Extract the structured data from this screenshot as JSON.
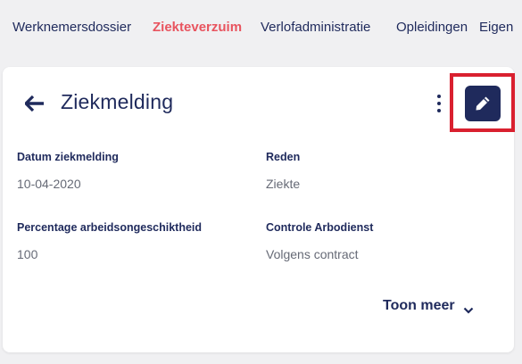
{
  "nav": {
    "tabs": [
      {
        "label": "Werknemersdossier"
      },
      {
        "label": "Ziekteverzuim"
      },
      {
        "label": "Verlofadministratie"
      },
      {
        "label": "Opleidingen"
      },
      {
        "label": "Eigen"
      }
    ],
    "active_tab": "Ziekteverzuim"
  },
  "card": {
    "title": "Ziekmelding",
    "fields": [
      {
        "label": "Datum ziekmelding",
        "value": "10-04-2020"
      },
      {
        "label": "Reden",
        "value": "Ziekte"
      },
      {
        "label": "Percentage arbeidsongeschiktheid",
        "value": "100"
      },
      {
        "label": "Controle Arbodienst",
        "value": "Volgens contract"
      }
    ],
    "toon_meer": "Toon meer"
  },
  "icons": {
    "back": "arrow-left-icon",
    "more": "kebab-menu-icon",
    "edit": "pencil-icon",
    "expand": "chevron-down-icon"
  },
  "colors": {
    "primary": "#1f2a5c",
    "active_tab": "#e8545f",
    "highlight": "#d9202f",
    "background": "#f0f0f2"
  }
}
